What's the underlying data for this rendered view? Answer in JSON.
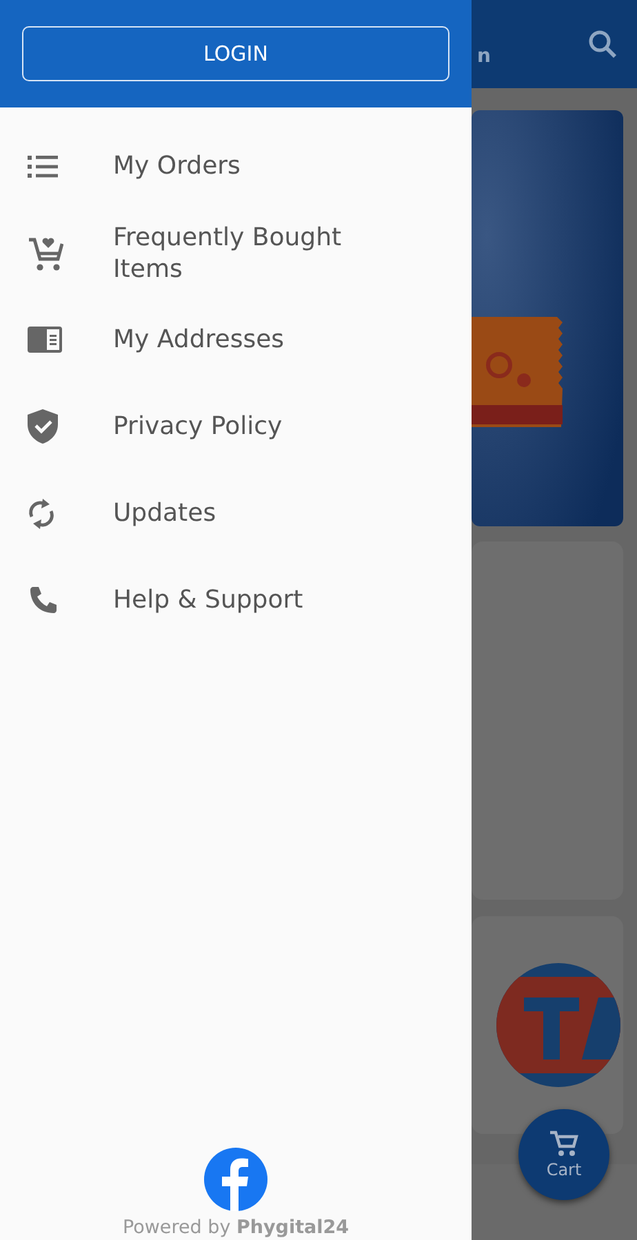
{
  "drawer": {
    "login_button": "LOGIN",
    "menu": [
      {
        "kind": "list",
        "label": "My Orders"
      },
      {
        "kind": "cart",
        "label": "Frequently Bought Items"
      },
      {
        "kind": "address",
        "label": "My Addresses"
      },
      {
        "kind": "shield",
        "label": "Privacy Policy"
      },
      {
        "kind": "sync",
        "label": "Updates"
      },
      {
        "kind": "phone",
        "label": "Help & Support"
      }
    ],
    "footer": "Powered by **Phygital24**"
  },
  "background_app": {
    "header_text": "n",
    "cart_button": "Cart"
  }
}
